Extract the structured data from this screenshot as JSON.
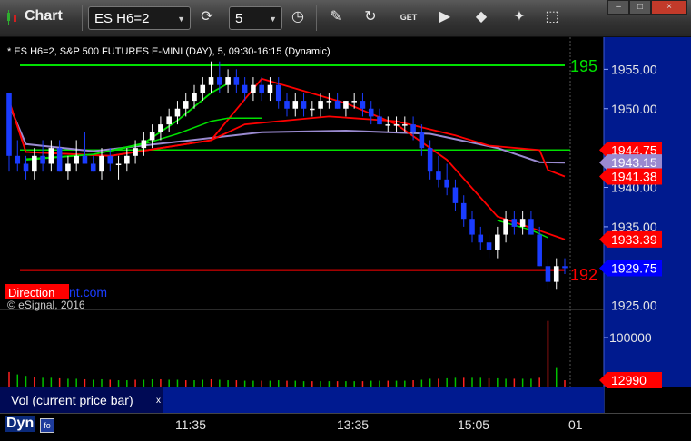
{
  "toolbar": {
    "title": "Chart",
    "symbol": "ES H6=2",
    "interval": "5",
    "window_minimize": "–",
    "window_maximize": "□",
    "window_close": "×",
    "icons": [
      "cycle-icon",
      "clock-icon",
      "pencil-icon",
      "refresh-icon",
      "get-icon",
      "play-icon",
      "tag-icon",
      "pin-icon"
    ]
  },
  "chart": {
    "header": "* ES H6=2, S&P 500 FUTURES E-MINI (DAY), 5, 09:30-16:15 (Dynamic)",
    "watermark_direction": "Direction",
    "watermark_rest": "nt.com",
    "copyright": "© eSignal, 2016",
    "level_upper_label": "195",
    "level_lower_label": "192",
    "price_axis": [
      "1955.00",
      "1950.00",
      "1945.00",
      "1940.00",
      "1935.00",
      "1930.00",
      "1925.00"
    ],
    "price_tags": [
      {
        "text": "1944.75",
        "color": "#ff0000"
      },
      {
        "text": "1943.15",
        "color": "#9a8ad0"
      },
      {
        "text": "1941.38",
        "color": "#ff0000"
      },
      {
        "text": "1933.39",
        "color": "#ff0000"
      },
      {
        "text": "1929.75",
        "color": "#0000ff"
      }
    ],
    "last_price": 1929.75
  },
  "volume": {
    "label": "Vol (current price bar)",
    "close": "x",
    "axis": [
      "100000"
    ],
    "tag": "12990"
  },
  "bottom": {
    "dyn": "Dyn",
    "dyn_icon": "fo",
    "time_labels": [
      "11:35",
      "13:35",
      "15:05",
      "01"
    ]
  },
  "colors": {
    "background": "#000000",
    "up_candle": "#ffffff",
    "down_candle": "#1a3cff",
    "green": "#00e000",
    "red": "#ff0000",
    "purple": "#9a8ad0"
  },
  "chart_data": {
    "type": "candlestick",
    "title": "* ES H6=2, S&P 500 FUTURES E-MINI (DAY), 5, 09:30-16:15 (Dynamic)",
    "ylim": [
      1924.5,
      1958.5
    ],
    "x_ticks": [
      "11:35",
      "13:35",
      "15:05",
      "01"
    ],
    "horizontal_levels": [
      {
        "name": "195",
        "value": 1955.5,
        "color": "#00e000"
      },
      {
        "name": "green_support",
        "value": 1944.75,
        "color": "#00e000"
      },
      {
        "name": "192",
        "value": 1929.5,
        "color": "#ff0000"
      },
      {
        "name": "red_flat",
        "value": 1944.75,
        "color": "#ff0000"
      }
    ],
    "candles_ohlc": [
      [
        1952,
        1952,
        1942,
        1944
      ],
      [
        1944,
        1946,
        1942,
        1943
      ],
      [
        1943,
        1944,
        1941,
        1942
      ],
      [
        1942,
        1945,
        1941,
        1944
      ],
      [
        1944,
        1946,
        1942,
        1943
      ],
      [
        1943,
        1946,
        1942,
        1945
      ],
      [
        1945,
        1946,
        1942,
        1942
      ],
      [
        1942,
        1944,
        1941,
        1943
      ],
      [
        1943,
        1946,
        1942,
        1944
      ],
      [
        1944,
        1947,
        1943,
        1943
      ],
      [
        1943,
        1944,
        1942,
        1942
      ],
      [
        1942,
        1945,
        1941,
        1944
      ],
      [
        1944,
        1945,
        1942,
        1943
      ],
      [
        1943,
        1944,
        1941,
        1943
      ],
      [
        1943,
        1945,
        1942,
        1944
      ],
      [
        1944,
        1946,
        1943,
        1945
      ],
      [
        1945,
        1947,
        1944,
        1946
      ],
      [
        1946,
        1948,
        1945,
        1947
      ],
      [
        1947,
        1949,
        1946,
        1948
      ],
      [
        1948,
        1950,
        1947,
        1949
      ],
      [
        1949,
        1951,
        1948,
        1950
      ],
      [
        1950,
        1952,
        1949,
        1951
      ],
      [
        1951,
        1953,
        1950,
        1952
      ],
      [
        1952,
        1954,
        1951,
        1953
      ],
      [
        1953,
        1956,
        1952,
        1954
      ],
      [
        1954,
        1956,
        1952,
        1953
      ],
      [
        1953,
        1955,
        1952,
        1954
      ],
      [
        1954,
        1955,
        1952,
        1953
      ],
      [
        1953,
        1954,
        1951,
        1952
      ],
      [
        1952,
        1954,
        1951,
        1953
      ],
      [
        1953,
        1954,
        1951,
        1952
      ],
      [
        1952,
        1954,
        1951,
        1953
      ],
      [
        1953,
        1954,
        1950,
        1951
      ],
      [
        1951,
        1952,
        1949,
        1950
      ],
      [
        1950,
        1952,
        1949,
        1951
      ],
      [
        1951,
        1952,
        1949,
        1950
      ],
      [
        1950,
        1951,
        1949,
        1950
      ],
      [
        1950,
        1952,
        1949,
        1951
      ],
      [
        1951,
        1952,
        1950,
        1951
      ],
      [
        1951,
        1952,
        1950,
        1950
      ],
      [
        1950,
        1951,
        1949,
        1951
      ],
      [
        1951,
        1952,
        1950,
        1951
      ],
      [
        1951,
        1952,
        1949,
        1950
      ],
      [
        1950,
        1951,
        1948,
        1949
      ],
      [
        1949,
        1950,
        1948,
        1948
      ],
      [
        1948,
        1949,
        1947,
        1948
      ],
      [
        1948,
        1949,
        1947,
        1948
      ],
      [
        1948,
        1949,
        1947,
        1948
      ],
      [
        1948,
        1949,
        1946,
        1947
      ],
      [
        1947,
        1948,
        1944,
        1945
      ],
      [
        1945,
        1946,
        1941,
        1942
      ],
      [
        1942,
        1944,
        1940,
        1941
      ],
      [
        1941,
        1943,
        1939,
        1940
      ],
      [
        1940,
        1941,
        1937,
        1938
      ],
      [
        1938,
        1939,
        1935,
        1936
      ],
      [
        1936,
        1937,
        1933,
        1934
      ],
      [
        1934,
        1935,
        1932,
        1933
      ],
      [
        1933,
        1934,
        1931,
        1932
      ],
      [
        1932,
        1935,
        1931,
        1934
      ],
      [
        1934,
        1937,
        1933,
        1936
      ],
      [
        1936,
        1937,
        1934,
        1935
      ],
      [
        1935,
        1937,
        1934,
        1936
      ],
      [
        1936,
        1937,
        1934,
        1934
      ],
      [
        1934,
        1935,
        1930,
        1930
      ],
      [
        1930,
        1931,
        1927,
        1928
      ],
      [
        1928,
        1931,
        1927,
        1930
      ],
      [
        1930,
        1931,
        1929,
        1929.75
      ]
    ],
    "volume": [
      30,
      25,
      22,
      20,
      18,
      18,
      17,
      16,
      16,
      15,
      14,
      15,
      14,
      13,
      13,
      14,
      14,
      15,
      15,
      14,
      14,
      13,
      13,
      14,
      15,
      14,
      13,
      13,
      12,
      12,
      12,
      12,
      13,
      12,
      12,
      11,
      11,
      11,
      11,
      11,
      11,
      11,
      11,
      12,
      12,
      12,
      12,
      12,
      13,
      14,
      16,
      16,
      17,
      18,
      18,
      18,
      18,
      17,
      17,
      16,
      16,
      16,
      16,
      18,
      135,
      40,
      12.99
    ],
    "volume_ylim": [
      0,
      140
    ]
  }
}
